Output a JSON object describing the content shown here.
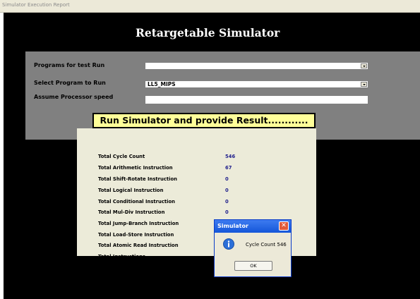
{
  "menubar": {
    "items": [
      "Simulator",
      "Execution Report"
    ]
  },
  "app": {
    "title": "Retargetable Simulator"
  },
  "form": {
    "programs_label": "Programs for test Run",
    "programs_value": "",
    "select_label": "Select Program to Run",
    "select_value": "LL5_MIPS",
    "speed_label": "Assume Processor speed",
    "speed_value": "",
    "run_button_label": "Run Simulator and provide Result............"
  },
  "results": {
    "rows": [
      {
        "label": "Total Cycle Count",
        "value": "546"
      },
      {
        "label": "Total Arithmetic Instruction",
        "value": "67"
      },
      {
        "label": "Total Shift-Rotate Instruction",
        "value": "0"
      },
      {
        "label": "Total Logical Instruction",
        "value": "0"
      },
      {
        "label": "Total Conditional Instruction",
        "value": "0"
      },
      {
        "label": "Total Mul-Div Instruction",
        "value": "0"
      },
      {
        "label": "Total  Jump-Branch Instruction",
        "value": "40"
      },
      {
        "label": "Total Load-Store Instruction",
        "value": ""
      },
      {
        "label": "Total  Atomic Read Instruction",
        "value": ""
      },
      {
        "label": "Total  Instructions",
        "value": ""
      }
    ]
  },
  "dialog": {
    "title": "Simulator",
    "message": "Cycle Count 546",
    "ok_label": "OK",
    "icon": "info-icon"
  },
  "colors": {
    "window_bg": "#000000",
    "panel_bg": "#808080",
    "result_bg": "#ecebd9",
    "run_button_bg": "#ffff99",
    "value_color": "#1f1f8c",
    "dialog_title_bg": "#1456d9"
  }
}
